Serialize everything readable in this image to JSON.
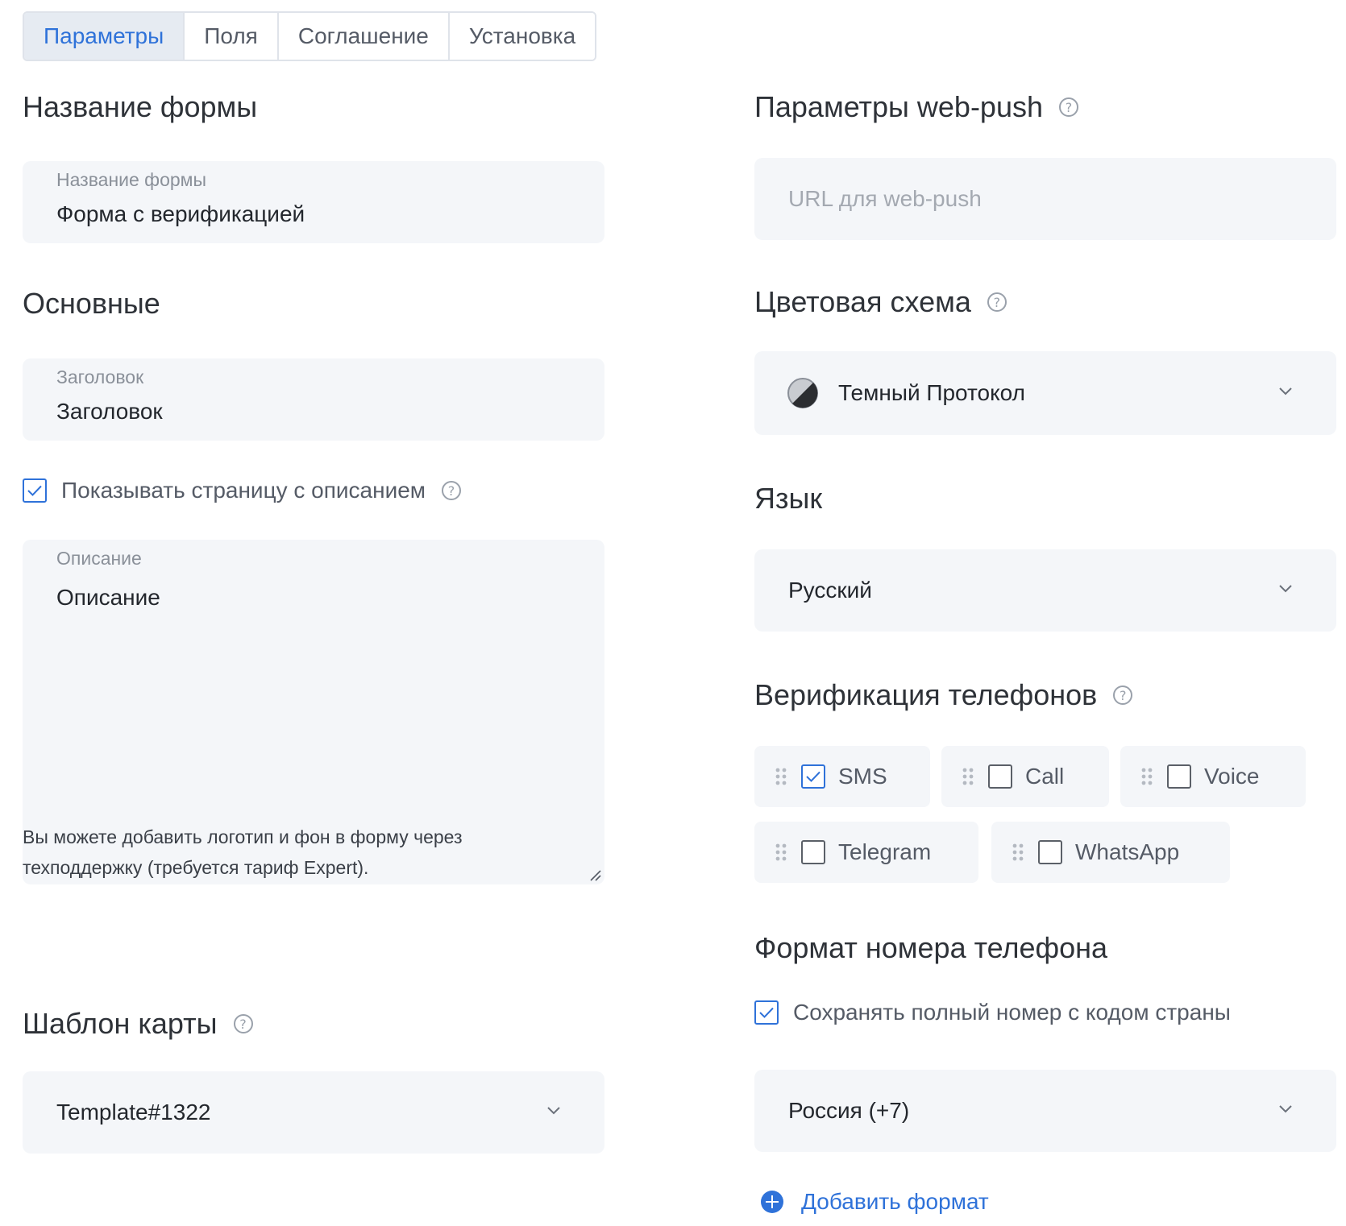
{
  "tabs": [
    {
      "label": "Параметры",
      "active": true
    },
    {
      "label": "Поля",
      "active": false
    },
    {
      "label": "Соглашение",
      "active": false
    },
    {
      "label": "Установка",
      "active": false
    }
  ],
  "left": {
    "form_name_heading": "Название формы",
    "form_name_field": {
      "label": "Название формы",
      "value": "Форма с верификацией"
    },
    "basic_heading": "Основные",
    "title_field": {
      "label": "Заголовок",
      "value": "Заголовок"
    },
    "show_description": {
      "label": "Показывать страницу с описанием",
      "checked": true
    },
    "description_field": {
      "label": "Описание",
      "value": "Описание"
    },
    "note": "Вы можете добавить логотип и фон в форму через техподдержку (требуется тариф Expert).",
    "card_template_heading": "Шаблон карты",
    "card_template_value": "Template#1322"
  },
  "right": {
    "webpush_heading": "Параметры web-push",
    "webpush_placeholder": "URL для web-push",
    "color_scheme_heading": "Цветовая схема",
    "color_scheme_value": "Темный Протокол",
    "language_heading": "Язык",
    "language_value": "Русский",
    "phone_verification_heading": "Верификация телефонов",
    "verification_methods": [
      {
        "label": "SMS",
        "checked": true
      },
      {
        "label": "Call",
        "checked": false
      },
      {
        "label": "Voice",
        "checked": false
      },
      {
        "label": "Telegram",
        "checked": false
      },
      {
        "label": "WhatsApp",
        "checked": false
      }
    ],
    "phone_format_heading": "Формат номера телефона",
    "save_full_number": {
      "label": "Сохранять полный номер с кодом страны",
      "checked": true
    },
    "country_value": "Россия (+7)",
    "add_format_label": "Добавить формат"
  },
  "icons": {
    "help": "?"
  },
  "colors": {
    "accent": "#2f72d9",
    "field_bg": "#f4f6f9",
    "tab_active_bg": "#e6ebf2"
  }
}
